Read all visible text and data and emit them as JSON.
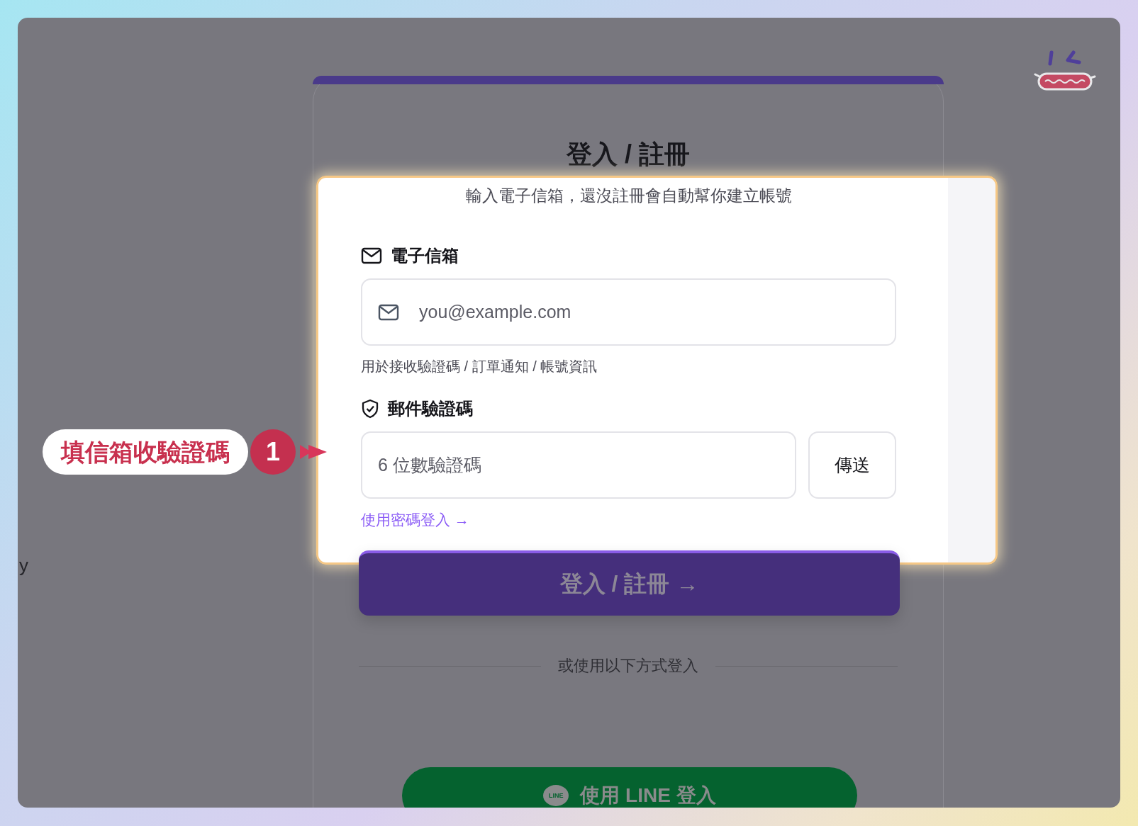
{
  "background_page": {
    "edge_text": "y"
  },
  "login_card": {
    "title": "登入 / 註冊",
    "subtitle": "輸入電子信箱，還沒註冊會自動幫你建立帳號",
    "email": {
      "label": "電子信箱",
      "placeholder": "you@example.com",
      "helper": "用於接收驗證碼 / 訂單通知 / 帳號資訊"
    },
    "code": {
      "label": "郵件驗證碼",
      "placeholder": "6 位數驗證碼",
      "send_button": "傳送"
    },
    "password_link": "使用密碼登入 →",
    "submit_button": "登入 / 註冊 →",
    "divider": "或使用以下方式登入",
    "line_button": {
      "icon_text": "LINE",
      "label": "使用 LINE 登入"
    }
  },
  "callout": {
    "text": "填信箱收驗證碼",
    "step": "1"
  }
}
